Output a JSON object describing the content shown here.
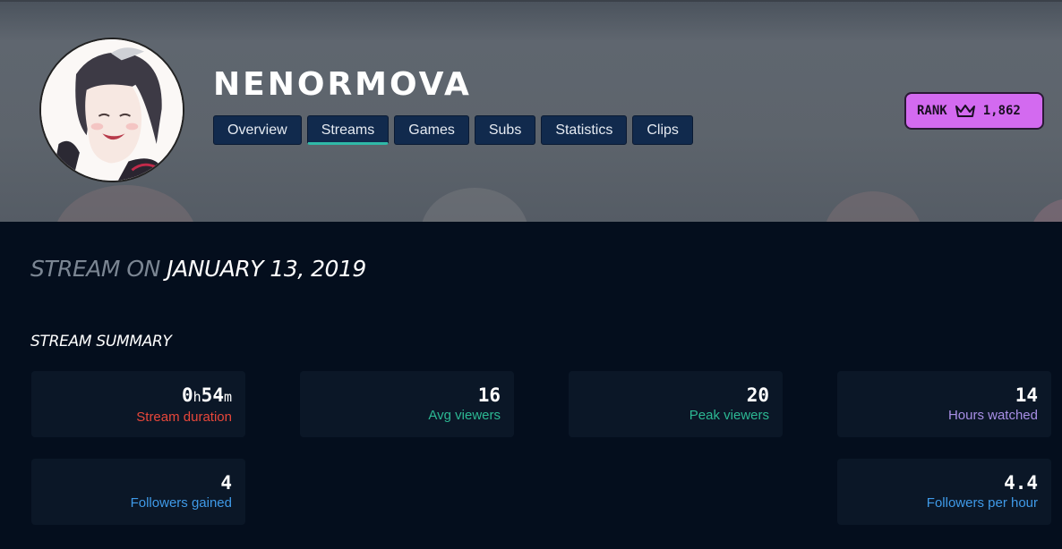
{
  "profile": {
    "username": "NENORMOVA",
    "rank_label": "RANK",
    "rank_value": "1,862"
  },
  "tabs": [
    {
      "label": "Overview",
      "active": false
    },
    {
      "label": "Streams",
      "active": true
    },
    {
      "label": "Games",
      "active": false
    },
    {
      "label": "Subs",
      "active": false
    },
    {
      "label": "Statistics",
      "active": false
    },
    {
      "label": "Clips",
      "active": false
    }
  ],
  "stream": {
    "title_prefix": "STREAM ON",
    "date": "JANUARY 13, 2019"
  },
  "summary": {
    "title": "STREAM SUMMARY",
    "duration": {
      "hours": "0",
      "h_unit": "h",
      "minutes": "54",
      "m_unit": "m",
      "label": "Stream duration"
    },
    "avg_viewers": {
      "value": "16",
      "label": "Avg viewers"
    },
    "peak_viewers": {
      "value": "20",
      "label": "Peak viewers"
    },
    "hours_watched": {
      "value": "14",
      "label": "Hours watched"
    },
    "followers_gained": {
      "value": "4",
      "label": "Followers gained"
    },
    "followers_per_hour": {
      "value": "4.4",
      "label": "Followers per hour"
    }
  },
  "colors": {
    "rank_badge": "#d36af0",
    "active_tab_underline": "#2fb9a8",
    "duration_label": "#e8473a",
    "viewers_label": "#2cb893",
    "hours_label": "#a88fe6",
    "followers_label": "#3f9ae8"
  },
  "icons": {
    "rank": "crown-icon"
  }
}
